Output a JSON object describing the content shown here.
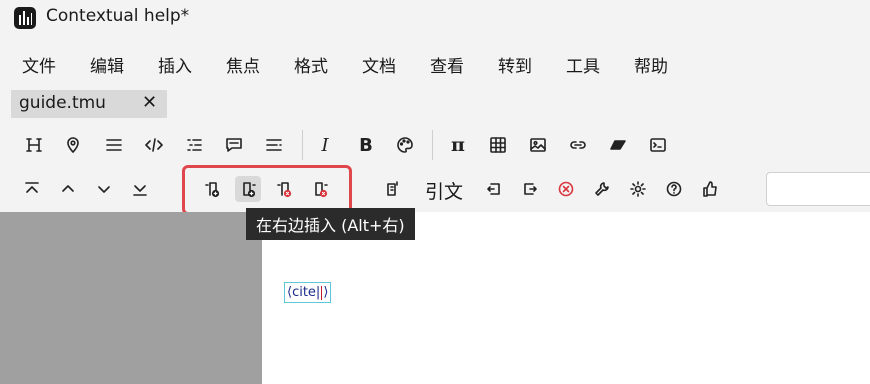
{
  "window": {
    "title": "Contextual help*"
  },
  "menu": [
    "文件",
    "编辑",
    "插入",
    "焦点",
    "格式",
    "文档",
    "查看",
    "转到",
    "工具",
    "帮助"
  ],
  "tab": {
    "label": "guide.tmu",
    "close": "✕"
  },
  "toolbar1": {
    "italic": "I",
    "bold": "B",
    "pi": "π"
  },
  "toolbar2": {
    "cite_label": "引文"
  },
  "tooltip": "在右边插入 (Alt+右)",
  "editor": {
    "cite_open": "⟨cite|",
    "cite_close": "⟩"
  },
  "colors": {
    "highlight": "#e0474c",
    "tooltip_bg": "#2b2b2b",
    "cite_border": "#5cc8d8",
    "error_red": "#d9363e"
  }
}
